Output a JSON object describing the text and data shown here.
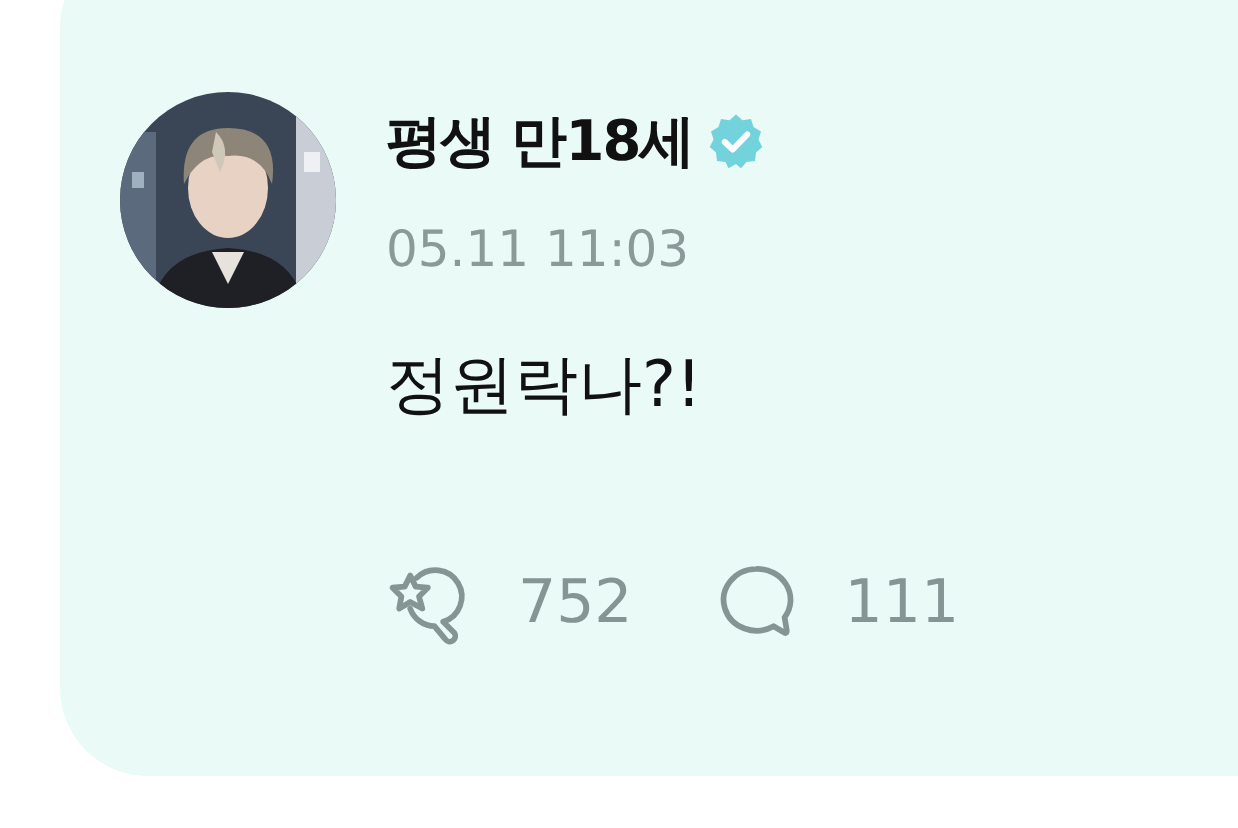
{
  "post": {
    "author": "평생 만18세",
    "verified": true,
    "time": "05.11 11:03",
    "text": "정원락나?!",
    "actions": [
      {
        "kind": "reaction",
        "count": "752"
      },
      {
        "kind": "comment",
        "count": "111"
      }
    ]
  }
}
